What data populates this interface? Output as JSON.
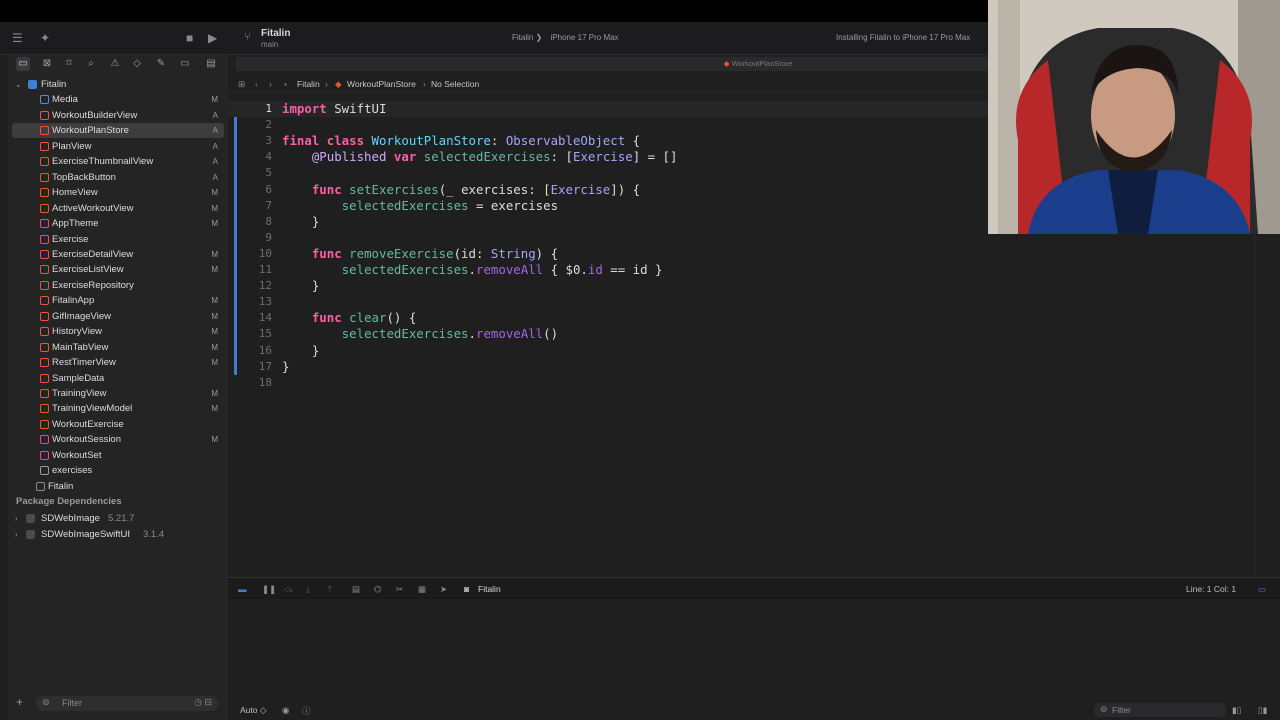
{
  "titlebar": {
    "project": "Fitalin",
    "branch": "main",
    "scheme": "Fitalin",
    "device": "iPhone 17 Pro Max",
    "status": "Installing Fitalin to iPhone 17 Pro Max"
  },
  "navigator": {
    "root": "Fitalin",
    "items": [
      {
        "label": "Media",
        "badge": "M",
        "kind": "folder"
      },
      {
        "label": "WorkoutBuilderView",
        "badge": "A",
        "kind": "swift"
      },
      {
        "label": "WorkoutPlanStore",
        "badge": "A",
        "kind": "swift",
        "selected": true
      },
      {
        "label": "PlanView",
        "badge": "A",
        "kind": "swift"
      },
      {
        "label": "ExerciseThumbnailView",
        "badge": "A",
        "kind": "swift"
      },
      {
        "label": "TopBackButton",
        "badge": "A",
        "kind": "swift"
      },
      {
        "label": "HomeView",
        "badge": "M",
        "kind": "swift"
      },
      {
        "label": "ActiveWorkoutView",
        "badge": "M",
        "kind": "swift"
      },
      {
        "label": "AppTheme",
        "badge": "M",
        "kind": "swift"
      },
      {
        "label": "Exercise",
        "badge": "",
        "kind": "swift"
      },
      {
        "label": "ExerciseDetailView",
        "badge": "M",
        "kind": "swift"
      },
      {
        "label": "ExerciseListView",
        "badge": "M",
        "kind": "swift"
      },
      {
        "label": "ExerciseRepository",
        "badge": "",
        "kind": "swift"
      },
      {
        "label": "FitalinApp",
        "badge": "M",
        "kind": "swift"
      },
      {
        "label": "GifImageView",
        "badge": "M",
        "kind": "swift"
      },
      {
        "label": "HistoryView",
        "badge": "M",
        "kind": "swift"
      },
      {
        "label": "MainTabView",
        "badge": "M",
        "kind": "swift"
      },
      {
        "label": "RestTimerView",
        "badge": "M",
        "kind": "swift"
      },
      {
        "label": "SampleData",
        "badge": "",
        "kind": "swift"
      },
      {
        "label": "TrainingView",
        "badge": "M",
        "kind": "swift"
      },
      {
        "label": "TrainingViewModel",
        "badge": "M",
        "kind": "swift"
      },
      {
        "label": "WorkoutExercise",
        "badge": "",
        "kind": "swift"
      },
      {
        "label": "WorkoutSession",
        "badge": "M",
        "kind": "swift"
      },
      {
        "label": "WorkoutSet",
        "badge": "",
        "kind": "swift"
      },
      {
        "label": "exercises",
        "badge": "",
        "kind": "json"
      },
      {
        "label": "Fitalin",
        "badge": "",
        "kind": "product"
      }
    ],
    "package_section": "Package Dependencies",
    "packages": [
      {
        "name": "SDWebImage",
        "version": "5.21.7"
      },
      {
        "name": "SDWebImageSwiftUI",
        "version": "3.1.4"
      }
    ],
    "filter_placeholder": "Filter"
  },
  "editor": {
    "tab_title": "WorkoutPlanStore",
    "breadcrumb": [
      "Fitalin",
      "WorkoutPlanStore",
      "No Selection"
    ],
    "lines": [
      [
        [
          "kw",
          "import"
        ],
        [
          "pl",
          " SwiftUI"
        ]
      ],
      [],
      [
        [
          "kw",
          "final class"
        ],
        [
          "pl",
          " "
        ],
        [
          "tn",
          "WorkoutPlanStore"
        ],
        [
          "pl",
          ": "
        ],
        [
          "ty",
          "ObservableObject"
        ],
        [
          "pl",
          " {"
        ]
      ],
      [
        [
          "pl",
          "    "
        ],
        [
          "at",
          "@Published"
        ],
        [
          "pl",
          " "
        ],
        [
          "kw",
          "var"
        ],
        [
          "pl",
          " "
        ],
        [
          "fn",
          "selectedExercises"
        ],
        [
          "pl",
          ": ["
        ],
        [
          "ty",
          "Exercise"
        ],
        [
          "pl",
          "] = []"
        ]
      ],
      [],
      [
        [
          "pl",
          "    "
        ],
        [
          "kw",
          "func"
        ],
        [
          "pl",
          " "
        ],
        [
          "fn",
          "setExercises"
        ],
        [
          "pl",
          "(_ exercises: ["
        ],
        [
          "ty",
          "Exercise"
        ],
        [
          "pl",
          "]) {"
        ]
      ],
      [
        [
          "pl",
          "        "
        ],
        [
          "fn",
          "selectedExercises"
        ],
        [
          "pl",
          " = exercises"
        ]
      ],
      [
        [
          "pl",
          "    }"
        ]
      ],
      [],
      [
        [
          "pl",
          "    "
        ],
        [
          "kw",
          "func"
        ],
        [
          "pl",
          " "
        ],
        [
          "fn",
          "removeExercise"
        ],
        [
          "pl",
          "(id: "
        ],
        [
          "ty",
          "String"
        ],
        [
          "pl",
          ") {"
        ]
      ],
      [
        [
          "pl",
          "        "
        ],
        [
          "fn",
          "selectedExercises"
        ],
        [
          "pl",
          "."
        ],
        [
          "mt",
          "removeAll"
        ],
        [
          "pl",
          " { $0."
        ],
        [
          "mt",
          "id"
        ],
        [
          "pl",
          " == id }"
        ]
      ],
      [
        [
          "pl",
          "    }"
        ]
      ],
      [],
      [
        [
          "pl",
          "    "
        ],
        [
          "kw",
          "func"
        ],
        [
          "pl",
          " "
        ],
        [
          "fn",
          "clear"
        ],
        [
          "pl",
          "() {"
        ]
      ],
      [
        [
          "pl",
          "        "
        ],
        [
          "fn",
          "selectedExercises"
        ],
        [
          "pl",
          "."
        ],
        [
          "mt",
          "removeAll"
        ],
        [
          "pl",
          "()"
        ]
      ],
      [
        [
          "pl",
          "    }"
        ]
      ],
      [
        [
          "pl",
          "}"
        ]
      ],
      []
    ],
    "current_line": 1
  },
  "debug": {
    "target": "Fitalin",
    "cursor": "Line: 1  Col: 1"
  },
  "bottombar": {
    "mode": "Auto ◇",
    "filter_placeholder": "Filter"
  },
  "colors": {
    "selected_row": "#3d3d40",
    "change_bar": "#3f7fd0",
    "keyword": "#fc5fa3",
    "type": "#a4a3ff"
  }
}
